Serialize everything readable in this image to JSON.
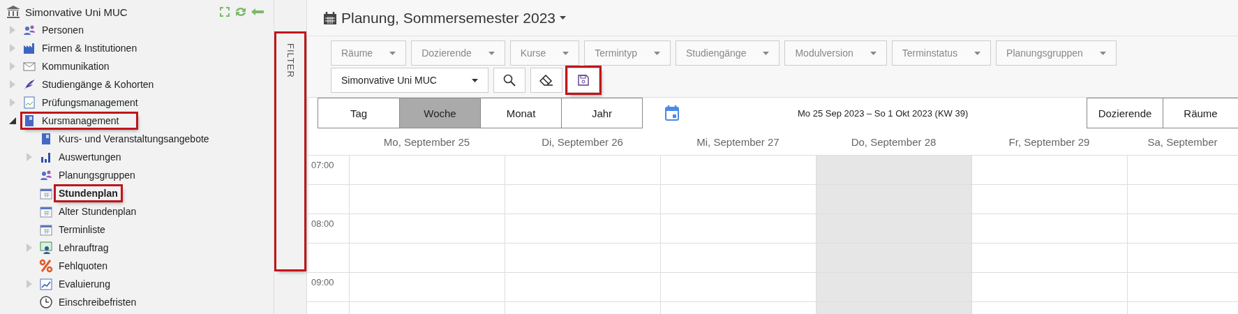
{
  "sidebar": {
    "root": {
      "label": "Simonvative Uni MUC"
    },
    "items": [
      {
        "label": "Personen",
        "kind": "people",
        "expanded": false,
        "selected": false,
        "highlighted": false
      },
      {
        "label": "Firmen & Institutionen",
        "kind": "factory",
        "expanded": false,
        "selected": false,
        "highlighted": false
      },
      {
        "label": "Kommunikation",
        "kind": "mail",
        "expanded": false,
        "selected": false,
        "highlighted": false
      },
      {
        "label": "Studiengänge & Kohorten",
        "kind": "feather",
        "expanded": false,
        "selected": false,
        "highlighted": false
      },
      {
        "label": "Prüfungsmanagement",
        "kind": "exam",
        "expanded": false,
        "selected": false,
        "highlighted": false
      },
      {
        "label": "Kursmanagement",
        "kind": "book",
        "expanded": true,
        "selected": false,
        "highlighted": true,
        "children": [
          {
            "label": "Kurs- und Veranstaltungsangebote",
            "kind": "book",
            "selected": false,
            "highlighted": false
          },
          {
            "label": "Auswertungen",
            "kind": "chart",
            "expanded": false,
            "selected": false,
            "highlighted": false
          },
          {
            "label": "Planungsgruppen",
            "kind": "people",
            "selected": false,
            "highlighted": false
          },
          {
            "label": "Stundenplan",
            "kind": "calendar",
            "selected": true,
            "highlighted": true
          },
          {
            "label": "Alter Stundenplan",
            "kind": "calendar",
            "selected": false,
            "highlighted": false
          },
          {
            "label": "Terminliste",
            "kind": "calendar",
            "selected": false,
            "highlighted": false
          },
          {
            "label": "Lehrauftrag",
            "kind": "teaching",
            "expanded": false,
            "selected": false,
            "highlighted": false
          },
          {
            "label": "Fehlquoten",
            "kind": "percent",
            "selected": false,
            "highlighted": false
          },
          {
            "label": "Evaluierung",
            "kind": "evaluation",
            "expanded": false,
            "selected": false,
            "highlighted": false
          },
          {
            "label": "Einschreibefristen",
            "kind": "clock",
            "selected": false,
            "highlighted": false
          }
        ]
      }
    ]
  },
  "filter_tab": {
    "label": "FILTER",
    "highlighted": true
  },
  "title": "Planung, Sommersemester 2023",
  "filters": [
    "Räume",
    "Dozierende",
    "Kurse",
    "Termintyp",
    "Studiengänge",
    "Modulversion",
    "Terminstatus",
    "Planungsgruppen"
  ],
  "scope_select": "Simonvative Uni MUC",
  "tool_buttons": [
    {
      "kind": "search",
      "highlighted": false
    },
    {
      "kind": "eraser",
      "highlighted": false
    },
    {
      "kind": "save",
      "highlighted": true
    }
  ],
  "views": [
    {
      "label": "Tag",
      "selected": false
    },
    {
      "label": "Woche",
      "selected": true
    },
    {
      "label": "Monat",
      "selected": false
    },
    {
      "label": "Jahr",
      "selected": false
    }
  ],
  "date_range": "Mo 25 Sep 2023 – So 1 Okt 2023 (KW 39)",
  "resource_buttons": [
    "Dozierende",
    "Räume"
  ],
  "days": [
    {
      "label": "Mo, September 25",
      "today": false
    },
    {
      "label": "Di, September 26",
      "today": false
    },
    {
      "label": "Mi, September 27",
      "today": false
    },
    {
      "label": "Do, September 28",
      "today": true
    },
    {
      "label": "Fr, September 29",
      "today": false
    },
    {
      "label": "Sa, September",
      "today": false
    }
  ],
  "times": [
    "07:00",
    "08:00",
    "09:00"
  ]
}
